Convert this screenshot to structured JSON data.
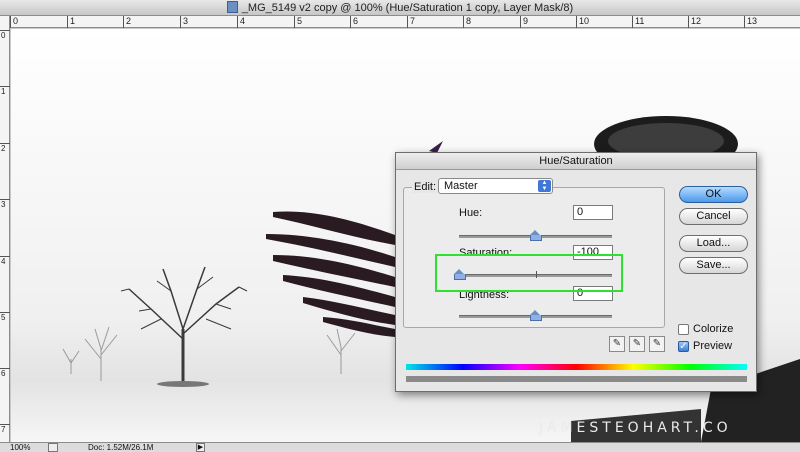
{
  "window": {
    "title": "_MG_5149 v2 copy @ 100% (Hue/Saturation 1 copy, Layer Mask/8)"
  },
  "ruler": {
    "top_ticks": [
      "0",
      "1",
      "2",
      "3",
      "4",
      "5",
      "6",
      "7",
      "8",
      "9",
      "10",
      "11",
      "12",
      "13"
    ],
    "left_ticks": [
      "0",
      "1",
      "2",
      "3",
      "4",
      "5",
      "6",
      "7"
    ]
  },
  "canvas": {
    "watermark": "JAMESTEOHART.CO"
  },
  "statusbar": {
    "zoom": "100%",
    "doc_info": "Doc: 1.52M/26.1M",
    "arrow": "▶"
  },
  "dialog": {
    "title": "Hue/Saturation",
    "edit_label": "Edit:",
    "edit_value": "Master",
    "hue_label": "Hue:",
    "hue_value": "0",
    "saturation_label": "Saturation:",
    "saturation_value": "-100",
    "saturation_level": -100,
    "lightness_label": "Lightness:",
    "lightness_value": "0",
    "buttons": {
      "ok": "OK",
      "cancel": "Cancel",
      "load": "Load...",
      "save": "Save..."
    },
    "colorize_label": "Colorize",
    "colorize_checked": false,
    "preview_label": "Preview",
    "preview_checked": true
  },
  "colors": {
    "highlight_box": "#2fe02f",
    "ok_button": "#4c99ec"
  }
}
